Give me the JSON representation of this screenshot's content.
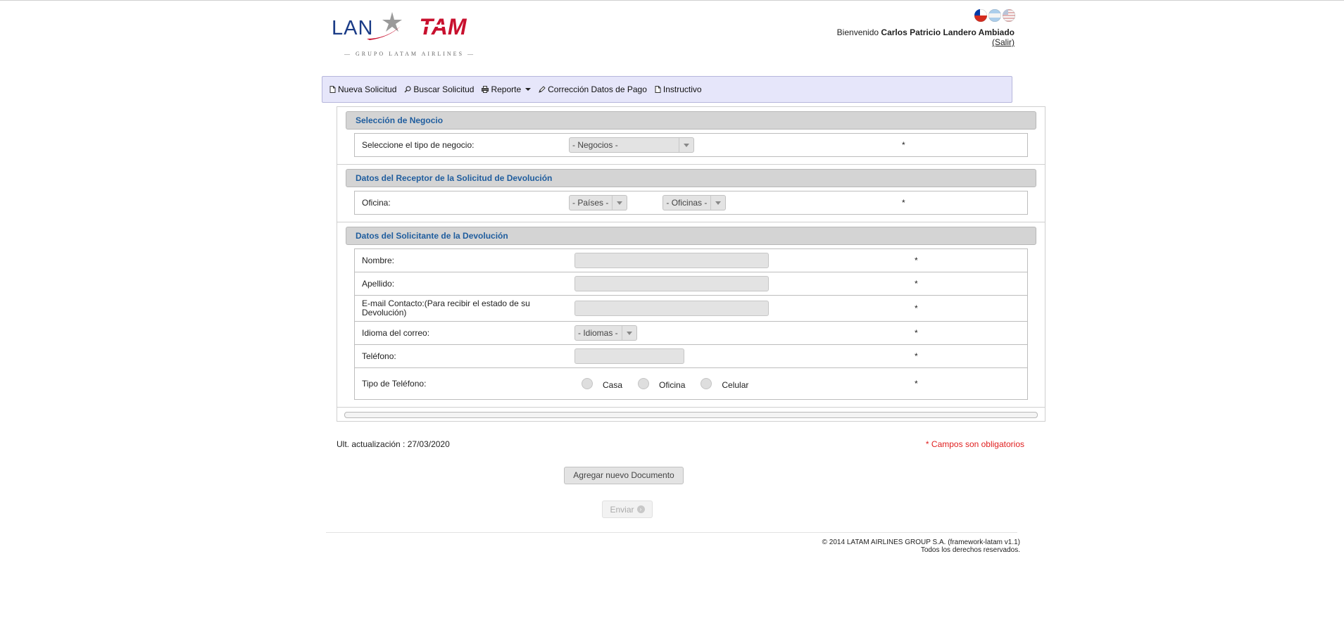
{
  "header": {
    "logo_lan": "LAN",
    "logo_tam": "TAM",
    "logo_subtitle": "— GRUPO LATAM AIRLINES —",
    "languages": [
      "chile-flag-icon",
      "argentina-flag-icon",
      "usa-flag-icon"
    ],
    "welcome_label": "Bienvenido",
    "user_name": "Carlos Patricio Landero Ambiado",
    "logout_label": "(Salir)"
  },
  "nav": {
    "items": [
      {
        "label": "Nueva Solicitud",
        "icon": "document-icon"
      },
      {
        "label": "Buscar Solicitud",
        "icon": "search-icon"
      },
      {
        "label": "Reporte",
        "icon": "printer-icon"
      },
      {
        "label": "Corrección Datos de Pago",
        "icon": "pencil-icon"
      },
      {
        "label": "Instructivo",
        "icon": "document-icon"
      }
    ]
  },
  "sections": {
    "negocio": {
      "title": "Selección de Negocio",
      "label": "Seleccione el tipo de negocio:",
      "select_value": "- Negocios -",
      "required": "*"
    },
    "receptor": {
      "title": "Datos del Receptor de la Solicitud de Devolución",
      "label": "Oficina:",
      "paises_value": "- Países -",
      "oficinas_value": "- Oficinas -",
      "required": "*"
    },
    "solicitante": {
      "title": "Datos del Solicitante de la Devolución",
      "nombre_label": "Nombre:",
      "apellido_label": "Apellido:",
      "email_label": "E-mail Contacto:(Para recibir el estado de su Devolución)",
      "idioma_label": "Idioma del correo:",
      "idioma_value": "- Idiomas -",
      "telefono_label": "Teléfono:",
      "tipo_telefono_label": "Tipo de Teléfono:",
      "phone_types": [
        "Casa",
        "Oficina",
        "Celular"
      ],
      "required": "*"
    }
  },
  "footer": {
    "updated": "Ult. actualización : 27/03/2020",
    "required_note": "* Campos son obligatorios",
    "add_document": "Agregar nuevo Documento",
    "send": "Enviar",
    "copyright": "© 2014 LATAM AIRLINES GROUP S.A. (framework-latam v1.1)",
    "rights": "Todos los derechos reservados."
  },
  "colors": {
    "nav_bg": "#e6e6fa",
    "section_title": "#1f5d9e",
    "required_note": "#e02020",
    "lan_blue": "#1b3c87",
    "tam_red": "#c8102e"
  }
}
